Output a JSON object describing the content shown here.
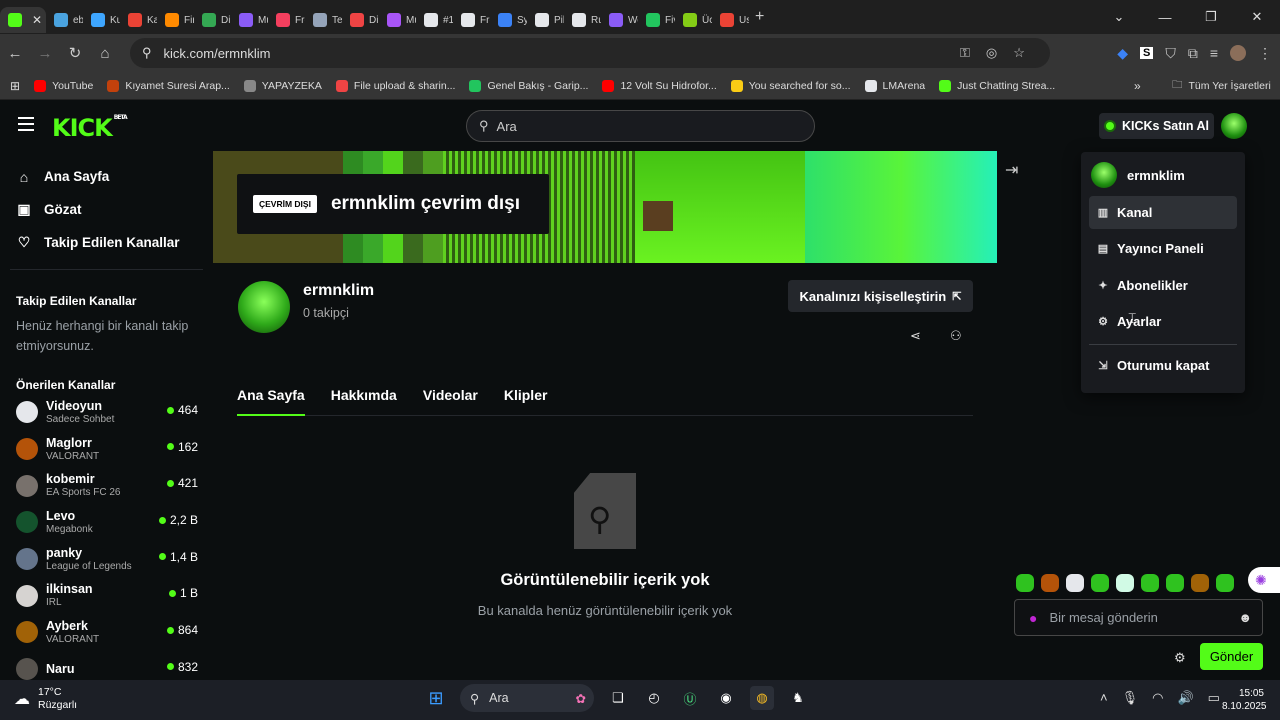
{
  "browser": {
    "tabs": [
      {
        "label": "",
        "color": "#53fc18",
        "active": true
      },
      {
        "label": "eb",
        "color": "#4aa3df"
      },
      {
        "label": "Ku",
        "color": "#3ea6ff"
      },
      {
        "label": "Ka",
        "color": "#ea4335"
      },
      {
        "label": "Fir",
        "color": "#ff8a00"
      },
      {
        "label": "Dik",
        "color": "#34a853"
      },
      {
        "label": "Mu",
        "color": "#8b5cf6"
      },
      {
        "label": "Fre",
        "color": "#f43f5e"
      },
      {
        "label": "Ter",
        "color": "#94a3b8"
      },
      {
        "label": "Dir",
        "color": "#ef4444"
      },
      {
        "label": "Mu",
        "color": "#a855f7"
      },
      {
        "label": "#1",
        "color": "#e5e7eb"
      },
      {
        "label": "Fre",
        "color": "#e5e7eb"
      },
      {
        "label": "Syr",
        "color": "#3b82f6"
      },
      {
        "label": "Pik",
        "color": "#e5e7eb"
      },
      {
        "label": "Ru",
        "color": "#e5e7eb"
      },
      {
        "label": "We",
        "color": "#8b5cf6"
      },
      {
        "label": "Fiv",
        "color": "#22c55e"
      },
      {
        "label": "Üc",
        "color": "#84cc16"
      },
      {
        "label": "Us",
        "color": "#ea4335"
      }
    ],
    "url": "kick.com/ermnklim",
    "bookmarks": [
      {
        "label": "YouTube",
        "color": "#ff0000"
      },
      {
        "label": "Kıyamet Suresi Arap...",
        "color": "#c2410c"
      },
      {
        "label": "YAPAYZEKA",
        "color": "#888888"
      },
      {
        "label": "File upload & sharin...",
        "color": "#ef4444"
      },
      {
        "label": "Genel Bakış - Garip...",
        "color": "#22c55e"
      },
      {
        "label": "12 Volt Su Hidrofor...",
        "color": "#ff0000"
      },
      {
        "label": "You searched for so...",
        "color": "#facc15"
      },
      {
        "label": "LMArena",
        "color": "#e5e7eb"
      },
      {
        "label": "Just Chatting Strea...",
        "color": "#53fc18"
      }
    ],
    "all_bookmarks": "Tüm Yer İşaretleri"
  },
  "header": {
    "logo": "KICK",
    "beta": "BETA",
    "search_placeholder": "Ara",
    "buy_label": "KICKs Satın Al"
  },
  "sidebar": {
    "nav": [
      {
        "label": "Ana Sayfa",
        "icon": "home-icon"
      },
      {
        "label": "Gözat",
        "icon": "browse-icon"
      },
      {
        "label": "Takip Edilen Kanallar",
        "icon": "heart-icon"
      }
    ],
    "followed_heading": "Takip Edilen Kanallar",
    "followed_empty": "Henüz herhangi bir kanalı takip etmiyorsunuz.",
    "recommended_heading": "Önerilen Kanallar",
    "recommended": [
      {
        "name": "Videoyun",
        "category": "Sadece Sohbet",
        "viewers": "464",
        "color": "#e5e7eb"
      },
      {
        "name": "Maglorr",
        "category": "VALORANT",
        "viewers": "162",
        "color": "#b45309"
      },
      {
        "name": "kobemir",
        "category": "EA Sports FC 26",
        "viewers": "421",
        "color": "#78716c"
      },
      {
        "name": "Levo",
        "category": "Megabonk",
        "viewers": "2,2 B",
        "color": "#14532d"
      },
      {
        "name": "panky",
        "category": "League of Legends",
        "viewers": "1,4 B",
        "color": "#64748b"
      },
      {
        "name": "ilkinsan",
        "category": "IRL",
        "viewers": "1 B",
        "color": "#d6d3d1"
      },
      {
        "name": "Ayberk",
        "category": "VALORANT",
        "viewers": "864",
        "color": "#a16207"
      },
      {
        "name": "Naru",
        "category": "",
        "viewers": "832",
        "color": "#57534e"
      }
    ]
  },
  "channel": {
    "offline_badge": "ÇEVRİM DIŞI",
    "offline_title": "ermnklim çevrim dışı",
    "username": "ermnklim",
    "followers": "0 takipçi",
    "customize_label": "Kanalınızı kişiselleştirin",
    "tabs": [
      "Ana Sayfa",
      "Hakkımda",
      "Videolar",
      "Klipler"
    ],
    "empty_title": "Görüntülenebilir içerik yok",
    "empty_subtitle": "Bu kanalda henüz görüntülenebilir içerik yok"
  },
  "dropdown": {
    "username": "ermnklim",
    "items": [
      {
        "label": "Kanal",
        "icon": "channel-icon"
      },
      {
        "label": "Yayıncı Paneli",
        "icon": "dashboard-icon"
      },
      {
        "label": "Abonelikler",
        "icon": "subscriptions-icon"
      },
      {
        "label": "Ayarlar",
        "icon": "gear-icon"
      }
    ],
    "logout": "Oturumu kapat"
  },
  "chat": {
    "placeholder": "Bir mesaj gönderin",
    "send_label": "Gönder"
  },
  "taskbar": {
    "temp": "17°C",
    "weather": "Rüzgarlı",
    "search": "Ara",
    "time": "15:05",
    "date": "8.10.2025"
  },
  "colors": {
    "accent": "#53fc18",
    "background": "#0b0e0f",
    "panel": "#191b1f"
  }
}
